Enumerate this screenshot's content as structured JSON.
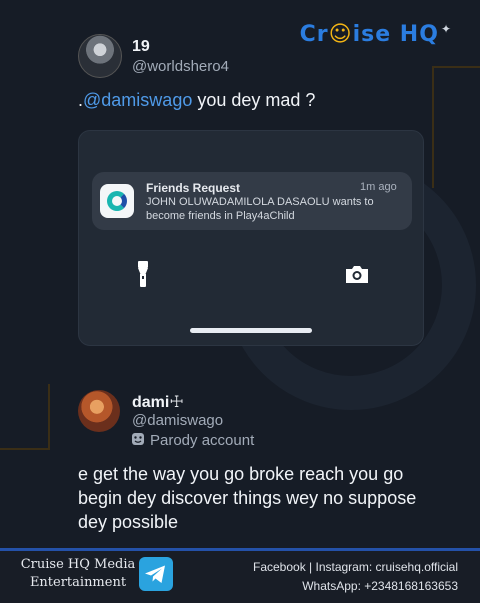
{
  "brand": {
    "name_pre": "Cr",
    "name_post": "ise HQ"
  },
  "post1": {
    "display_name": "19",
    "handle": "@worldshero4",
    "text_prefix": ".",
    "mention": "@damiswago",
    "text_suffix": " you dey mad ?"
  },
  "notification": {
    "title": "Friends Request",
    "time": "1m ago",
    "body": "JOHN OLUWADAMILOLA DASAOLU wants to become friends in Play4aChild"
  },
  "post2": {
    "display_name": "dami☩",
    "handle": "@damiswago",
    "label": "Parody account",
    "text": "e get the way you go broke reach you go begin dey discover things wey no suppose dey possible"
  },
  "footer": {
    "org_line1": "Cruise HQ Media",
    "org_line2": "Entertainment",
    "social": "Facebook | Instagram: cruisehq.official",
    "whatsapp": "WhatsApp: +2348168163653"
  },
  "colors": {
    "background": "#161c26",
    "mention": "#4f9ae8",
    "brand_blue": "#2b7de0",
    "brand_yellow": "#f3b515"
  },
  "icons": [
    "flashlight-icon",
    "camera-icon",
    "parody-mask-icon",
    "telegram-icon",
    "app-logo-icon"
  ]
}
